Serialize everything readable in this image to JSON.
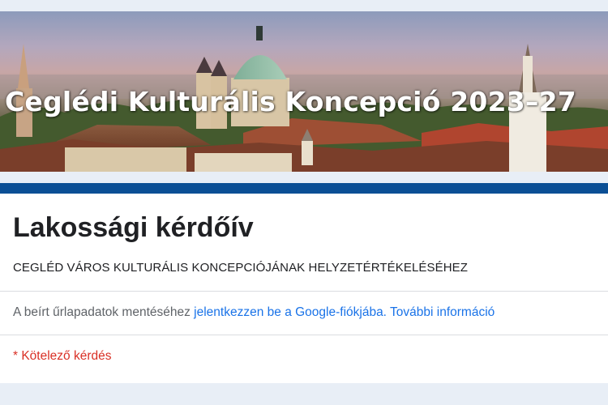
{
  "banner": {
    "title": "Ceglédi Kulturális Koncepció 2023–27"
  },
  "form": {
    "title": "Lakossági kérdőív",
    "description": "CEGLÉD VÁROS KULTURÁLIS KONCEPCIÓJÁNAK HELYZETÉRTÉKELÉSÉHEZ",
    "signin_prefix": "A beírt űrlapadatok mentéséhez ",
    "signin_link": "jelentkezzen be a Google-fiókjába.",
    "more_info_link": "További információ",
    "required_note": "* Kötelező kérdés"
  },
  "colors": {
    "accent": "#0b4f95",
    "link": "#1a73e8",
    "required": "#d93025",
    "page_background": "#e8eef6"
  }
}
